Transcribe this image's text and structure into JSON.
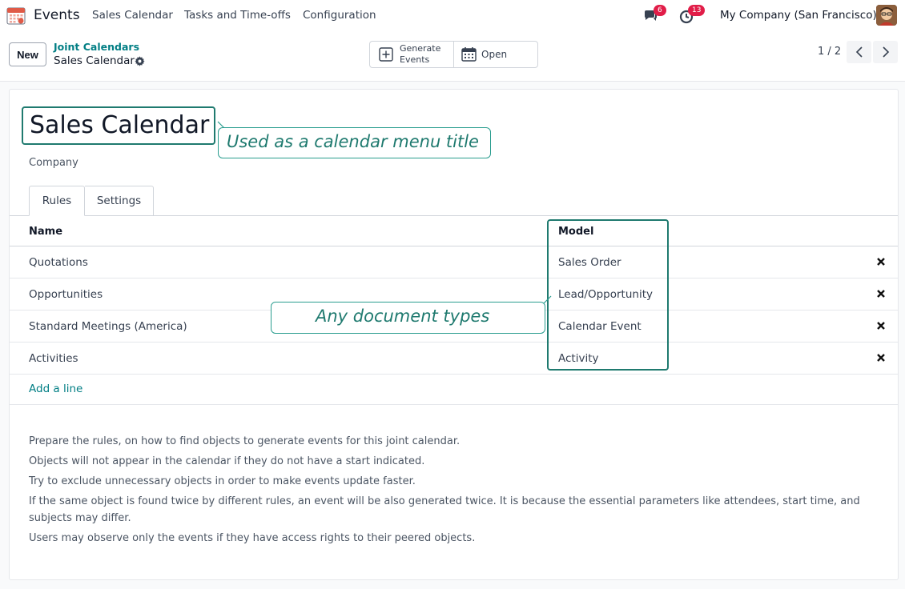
{
  "navbar": {
    "app_name": "Events",
    "menu": [
      "Sales Calendar",
      "Tasks and Time-offs",
      "Configuration"
    ],
    "messages_count": "6",
    "activities_count": "13",
    "company": "My Company (San Francisco)",
    "icons": [
      "calendar-app-icon",
      "chat-icon",
      "clock-icon",
      "avatar"
    ]
  },
  "control_panel": {
    "new_label": "New",
    "breadcrumb_parent": "Joint Calendars",
    "breadcrumb_current": "Sales Calendar",
    "generate_label_1": "Generate",
    "generate_label_2": "Events",
    "open_label": "Open",
    "pager": "1 / 2"
  },
  "form": {
    "title": "Sales Calendar",
    "title_callout": "Used as a calendar menu title",
    "company_label": "Company",
    "tabs": [
      "Rules",
      "Settings"
    ],
    "columns": [
      "Name",
      "Model"
    ],
    "rows": [
      {
        "name": "Quotations",
        "model": "Sales Order"
      },
      {
        "name": "Opportunities",
        "model": "Lead/Opportunity"
      },
      {
        "name": "Standard Meetings (America)",
        "model": "Calendar Event"
      },
      {
        "name": "Activities",
        "model": "Activity"
      }
    ],
    "model_callout": "Any document types",
    "add_line": "Add a line",
    "help": [
      "Prepare the rules, on how to find objects to generate events for this joint calendar.",
      "Objects will not appear in the calendar if they do not have a start indicated.",
      "Try to exclude unnecessary objects in order to make events update faster.",
      "If the same object is found twice by different rules, an event will be also generated twice. It is because the essential parameters like attendees, start time, and subjects may differ.",
      "Users may observe only the events if they have access rights to their peered objects."
    ]
  },
  "colors": {
    "accent": "#017e84",
    "callout": "#1f7a6f",
    "badge": "#e11d48"
  }
}
